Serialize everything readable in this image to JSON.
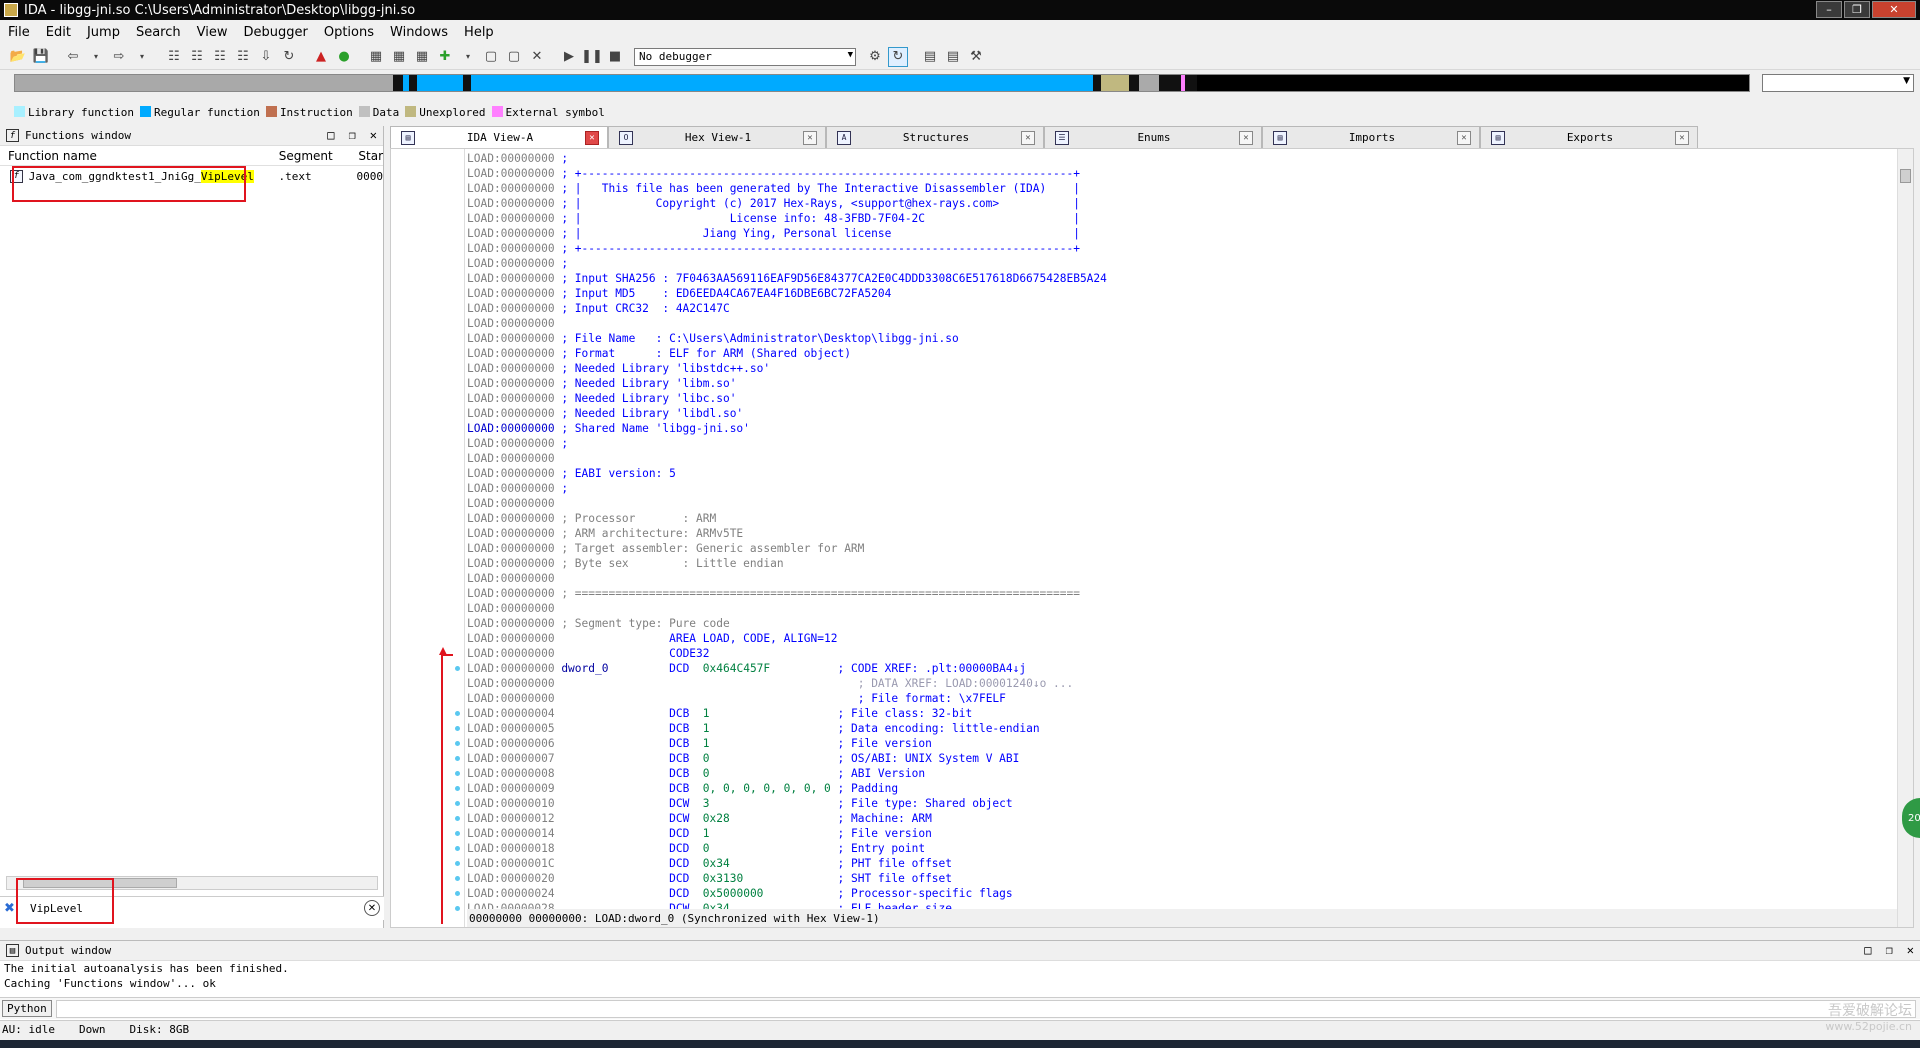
{
  "window": {
    "title": "IDA - libgg-jni.so C:\\Users\\Administrator\\Desktop\\libgg-jni.so"
  },
  "menu": [
    "File",
    "Edit",
    "Jump",
    "Search",
    "View",
    "Debugger",
    "Options",
    "Windows",
    "Help"
  ],
  "toolbar": {
    "debugger_select": "No debugger"
  },
  "legend": [
    {
      "label": "Library function",
      "color": "#a8f0ff"
    },
    {
      "label": "Regular function",
      "color": "#00aaff"
    },
    {
      "label": "Instruction",
      "color": "#c07050"
    },
    {
      "label": "Data",
      "color": "#c0c0c0"
    },
    {
      "label": "Unexplored",
      "color": "#c0b880"
    },
    {
      "label": "External symbol",
      "color": "#ff80ff"
    }
  ],
  "functions_window": {
    "title": "Functions window",
    "columns": [
      "Function name",
      "Segment",
      "Star"
    ],
    "rows": [
      {
        "name_prefix": "Java_com_ggndktest1_JniGg_",
        "name_match": "VipLevel",
        "segment": ".text",
        "start": "0000"
      }
    ],
    "filter": "VipLevel"
  },
  "tabs": [
    {
      "label": "IDA View-A",
      "icon": "ida-view-icon",
      "active": true
    },
    {
      "label": "Hex View-1",
      "icon": "hex-view-icon",
      "active": false
    },
    {
      "label": "Structures",
      "icon": "structures-icon",
      "active": false
    },
    {
      "label": "Enums",
      "icon": "enums-icon",
      "active": false
    },
    {
      "label": "Imports",
      "icon": "imports-icon",
      "active": false
    },
    {
      "label": "Exports",
      "icon": "exports-icon",
      "active": false
    }
  ],
  "disasm": {
    "lines": [
      {
        "addr": "LOAD:00000000",
        "text": ";"
      },
      {
        "addr": "LOAD:00000000",
        "text": "; +-------------------------------------------------------------------------+"
      },
      {
        "addr": "LOAD:00000000",
        "text": "; |   This file has been generated by The Interactive Disassembler (IDA)    |"
      },
      {
        "addr": "LOAD:00000000",
        "text": "; |           Copyright (c) 2017 Hex-Rays, <support@hex-rays.com>           |"
      },
      {
        "addr": "LOAD:00000000",
        "text": "; |                      License info: 48-3FBD-7F04-2C                      |"
      },
      {
        "addr": "LOAD:00000000",
        "text": "; |                  Jiang Ying, Personal license                           |"
      },
      {
        "addr": "LOAD:00000000",
        "text": "; +-------------------------------------------------------------------------+"
      },
      {
        "addr": "LOAD:00000000",
        "text": ";"
      },
      {
        "addr": "LOAD:00000000",
        "text": "; Input SHA256 : 7F0463AA569116EAF9D56E84377CA2E0C4DDD3308C6E517618D6675428EB5A24"
      },
      {
        "addr": "LOAD:00000000",
        "text": "; Input MD5    : ED6EEDA4CA67EA4F16DBE6BC72FA5204"
      },
      {
        "addr": "LOAD:00000000",
        "text": "; Input CRC32  : 4A2C147C"
      },
      {
        "addr": "LOAD:00000000",
        "text": ""
      },
      {
        "addr": "LOAD:00000000",
        "text": "; File Name   : C:\\Users\\Administrator\\Desktop\\libgg-jni.so"
      },
      {
        "addr": "LOAD:00000000",
        "text": "; Format      : ELF for ARM (Shared object)"
      },
      {
        "addr": "LOAD:00000000",
        "text": "; Needed Library 'libstdc++.so'"
      },
      {
        "addr": "LOAD:00000000",
        "text": "; Needed Library 'libm.so'"
      },
      {
        "addr": "LOAD:00000000",
        "text": "; Needed Library 'libc.so'"
      },
      {
        "addr": "LOAD:00000000",
        "text": "; Needed Library 'libdl.so'"
      },
      {
        "addr": "LOAD:00000000",
        "text": "; Shared Name 'libgg-jni.so'",
        "current": true
      },
      {
        "addr": "LOAD:00000000",
        "text": ";"
      },
      {
        "addr": "LOAD:00000000",
        "text": ""
      },
      {
        "addr": "LOAD:00000000",
        "text": "; EABI version: 5"
      },
      {
        "addr": "LOAD:00000000",
        "text": ";"
      },
      {
        "addr": "LOAD:00000000",
        "text": ""
      },
      {
        "addr": "LOAD:00000000",
        "text": "; Processor       : ARM",
        "gray": true
      },
      {
        "addr": "LOAD:00000000",
        "text": "; ARM architecture: ARMv5TE",
        "gray": true
      },
      {
        "addr": "LOAD:00000000",
        "text": "; Target assembler: Generic assembler for ARM",
        "gray": true
      },
      {
        "addr": "LOAD:00000000",
        "text": "; Byte sex        : Little endian",
        "gray": true
      },
      {
        "addr": "LOAD:00000000",
        "text": ""
      },
      {
        "addr": "LOAD:00000000",
        "text": "; ===========================================================================",
        "gray": true
      },
      {
        "addr": "LOAD:00000000",
        "text": ""
      },
      {
        "addr": "LOAD:00000000",
        "text": "; Segment type: Pure code",
        "gray": true
      },
      {
        "addr": "LOAD:00000000",
        "label": "",
        "mnem": "AREA LOAD, CODE, ALIGN=12"
      },
      {
        "addr": "LOAD:00000000",
        "label": "",
        "mnem": "CODE32"
      },
      {
        "addr": "LOAD:00000000",
        "label": "dword_0",
        "mnem": "DCD",
        "op": "0x464C457F",
        "comment": "; CODE XREF: .plt:00000BA4↓j"
      },
      {
        "addr": "LOAD:00000000",
        "label": "",
        "mnem": "",
        "op": "",
        "xref": "; DATA XREF: LOAD:00001240↓o ..."
      },
      {
        "addr": "LOAD:00000000",
        "label": "",
        "mnem": "",
        "op": "",
        "comment": "; File format: \\x7FELF"
      },
      {
        "addr": "LOAD:00000004",
        "label": "",
        "mnem": "DCB",
        "op": "1",
        "comment": "; File class: 32-bit"
      },
      {
        "addr": "LOAD:00000005",
        "label": "",
        "mnem": "DCB",
        "op": "1",
        "comment": "; Data encoding: little-endian"
      },
      {
        "addr": "LOAD:00000006",
        "label": "",
        "mnem": "DCB",
        "op": "1",
        "comment": "; File version"
      },
      {
        "addr": "LOAD:00000007",
        "label": "",
        "mnem": "DCB",
        "op": "0",
        "comment": "; OS/ABI: UNIX System V ABI"
      },
      {
        "addr": "LOAD:00000008",
        "label": "",
        "mnem": "DCB",
        "op": "0",
        "comment": "; ABI Version"
      },
      {
        "addr": "LOAD:00000009",
        "label": "",
        "mnem": "DCB",
        "op": "0, 0, 0, 0, 0, 0, 0",
        "comment": "; Padding"
      },
      {
        "addr": "LOAD:00000010",
        "label": "",
        "mnem": "DCW",
        "op": "3",
        "comment": "; File type: Shared object"
      },
      {
        "addr": "LOAD:00000012",
        "label": "",
        "mnem": "DCW",
        "op": "0x28",
        "comment": "; Machine: ARM"
      },
      {
        "addr": "LOAD:00000014",
        "label": "",
        "mnem": "DCD",
        "op": "1",
        "comment": "; File version"
      },
      {
        "addr": "LOAD:00000018",
        "label": "",
        "mnem": "DCD",
        "op": "0",
        "comment": "; Entry point"
      },
      {
        "addr": "LOAD:0000001C",
        "label": "",
        "mnem": "DCD",
        "op": "0x34",
        "comment": "; PHT file offset"
      },
      {
        "addr": "LOAD:00000020",
        "label": "",
        "mnem": "DCD",
        "op": "0x3130",
        "comment": "; SHT file offset"
      },
      {
        "addr": "LOAD:00000024",
        "label": "",
        "mnem": "DCD",
        "op": "0x5000000",
        "comment": "; Processor-specific flags"
      },
      {
        "addr": "LOAD:00000028",
        "label": "",
        "mnem": "DCW",
        "op": "0x34",
        "comment": "; ELF header size"
      }
    ],
    "status": "00000000 00000000: LOAD:dword_0 (Synchronized with Hex View-1)"
  },
  "output_window": {
    "title": "Output window",
    "lines": [
      "The initial autoanalysis has been finished.",
      "Caching 'Functions window'... ok"
    ],
    "cli_label": "Python"
  },
  "statusbar": {
    "au": "AU:  idle",
    "dir": "Down",
    "disk": "Disk: 8GB"
  },
  "watermark": "吾爱破解论坛",
  "watermark_url": "www.52pojie.cn",
  "side_badge": "20"
}
